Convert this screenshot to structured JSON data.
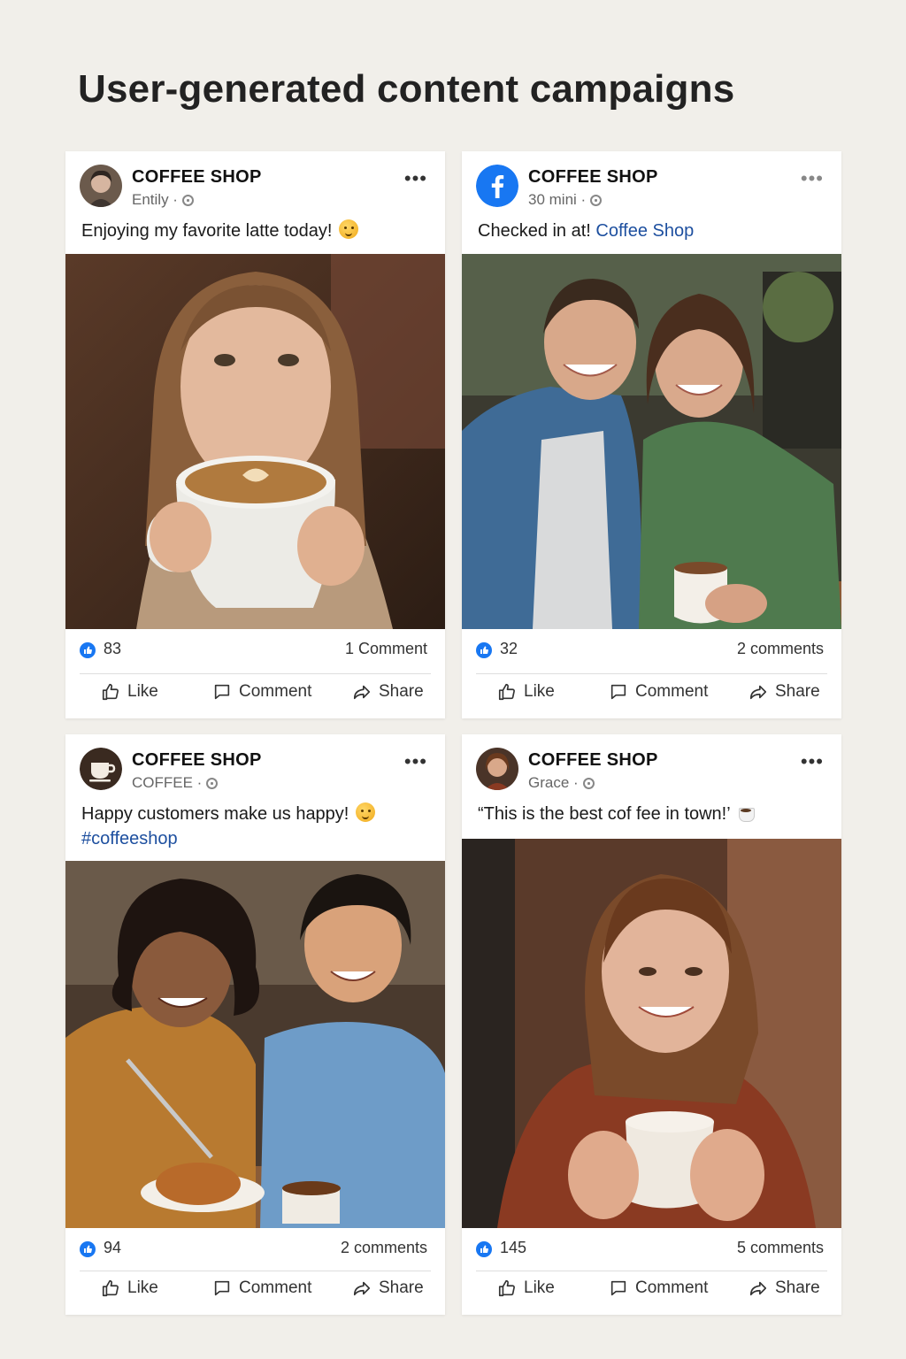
{
  "title": "User-generated content campaigns",
  "actions": {
    "like": "Like",
    "comment": "Comment",
    "share": "Share"
  },
  "posts": [
    {
      "page": "COFFEE SHOP",
      "meta": "Entily ·",
      "caption": "Enjoying my favorite latte today!",
      "likes": "83",
      "comments": "1 Comment",
      "avatar": "user-avatar",
      "photo": "woman-drinking-latte"
    },
    {
      "page": "COFFEE SHOP",
      "meta": "30 mini ·",
      "caption": "Checked in at!",
      "caption_link": "Coffee Shop",
      "likes": "32",
      "comments": "2 comments",
      "avatar": "facebook-logo",
      "photo": "couple-at-cafe"
    },
    {
      "page": "COFFEE SHOP",
      "meta": "COFFEE ·",
      "caption": "Happy customers make us happy!",
      "hashtag": "#coffeeshop",
      "likes": "94",
      "comments": "2 comments",
      "avatar": "coffee-cup-logo",
      "photo": "friends-eating-pastry"
    },
    {
      "page": "COFFEE SHOP",
      "meta": "Grace ·",
      "caption": "“This is the best cof fee in town!’",
      "likes": "145",
      "comments": "5 comments",
      "avatar": "user-avatar",
      "photo": "woman-holding-coffee"
    }
  ],
  "colors": {
    "facebook_blue": "#1877f2",
    "link": "#1d4f9f",
    "background": "#f1efea"
  }
}
